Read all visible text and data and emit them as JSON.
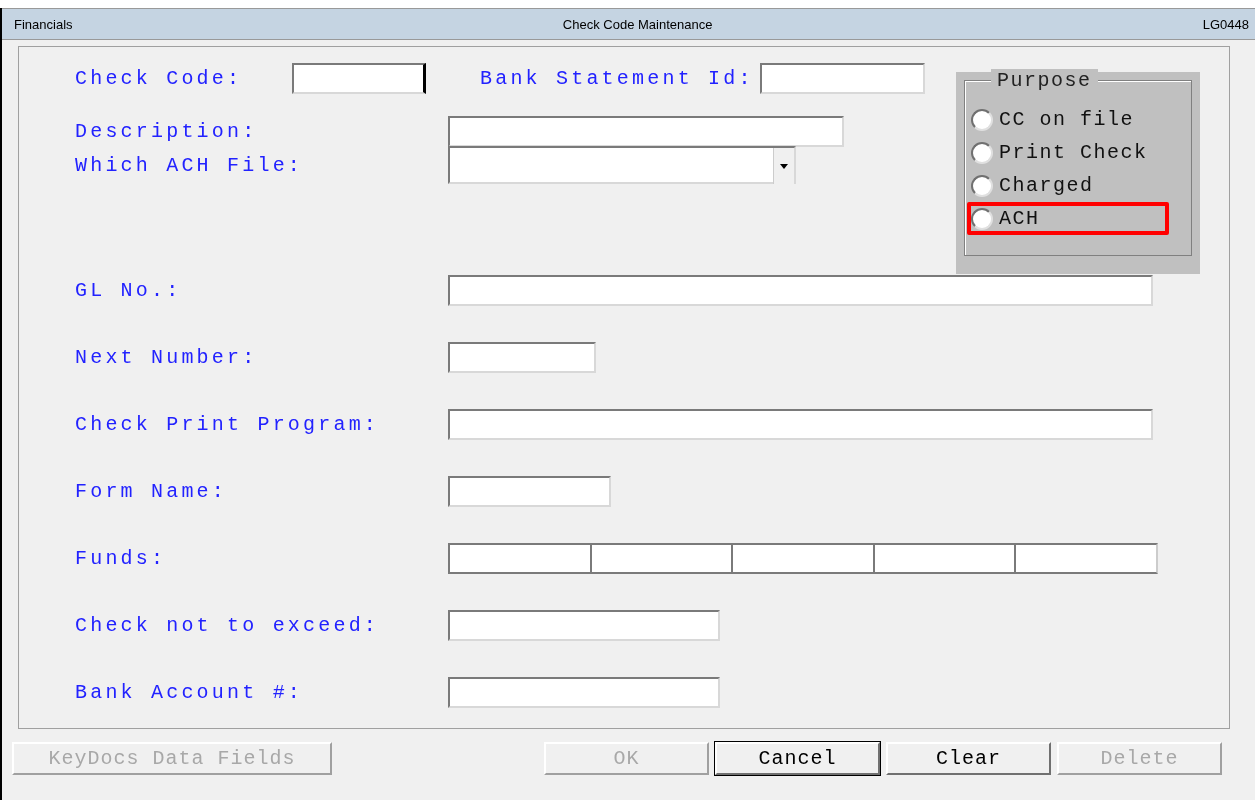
{
  "window": {
    "module": "Financials",
    "title": "Check Code Maintenance",
    "code": "LG0448"
  },
  "top_fields": [
    {
      "label": "Check Code:",
      "kind": "text"
    },
    {
      "label": "Bank Statement Id:",
      "kind": "text"
    }
  ],
  "upper_fields": [
    {
      "label": "Description:",
      "kind": "text"
    },
    {
      "label": "Which ACH File:",
      "kind": "dropdown"
    }
  ],
  "purpose": {
    "title": "Purpose",
    "options": [
      {
        "label": "CC on file",
        "selected": false,
        "highlighted": false
      },
      {
        "label": "Print Check",
        "selected": false,
        "highlighted": false
      },
      {
        "label": "Charged",
        "selected": false,
        "highlighted": false
      },
      {
        "label": "ACH",
        "selected": false,
        "highlighted": true
      }
    ]
  },
  "fields": [
    {
      "label": "GL No.:",
      "kind": "text"
    },
    {
      "label": "Next Number:",
      "kind": "text"
    },
    {
      "label": "Check Print Program:",
      "kind": "text"
    },
    {
      "label": "Form Name:",
      "kind": "text"
    },
    {
      "label": "Funds:",
      "kind": "multi",
      "parts": [
        {
          "kind": "text"
        },
        {
          "kind": "text"
        },
        {
          "kind": "text"
        },
        {
          "kind": "text"
        },
        {
          "kind": "text"
        }
      ]
    },
    {
      "label": "Check not to exceed:",
      "kind": "text"
    },
    {
      "label": "Bank Account #:",
      "kind": "text"
    }
  ],
  "buttons": [
    {
      "label": "KeyDocs Data Fields",
      "disabled": true
    },
    {
      "label": "OK",
      "disabled": true
    },
    {
      "label": "Cancel",
      "disabled": false
    },
    {
      "label": "Clear",
      "disabled": false
    },
    {
      "label": "Delete",
      "disabled": true
    }
  ]
}
